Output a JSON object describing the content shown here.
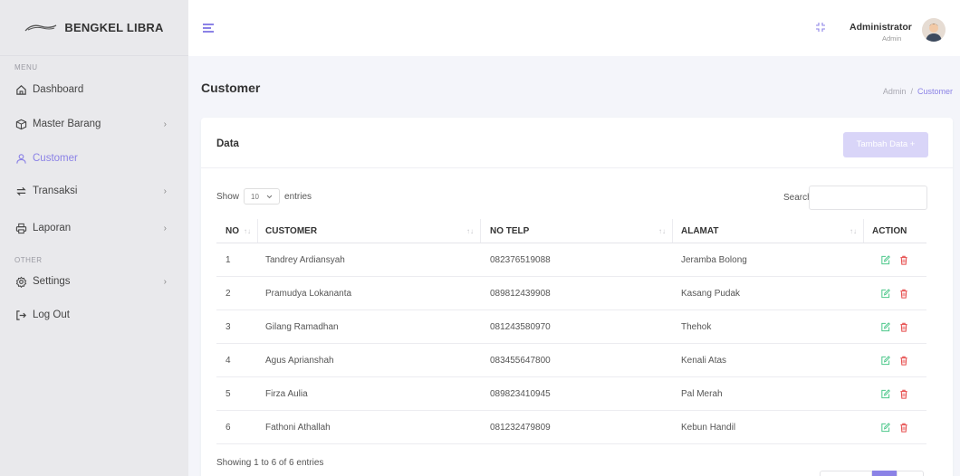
{
  "brand": {
    "name": "BENGKEL LIBRA"
  },
  "sidebar": {
    "menu_label": "MENU",
    "other_label": "OTHER",
    "items": [
      {
        "label": "Dashboard",
        "icon": "home-icon"
      },
      {
        "label": "Master Barang",
        "icon": "box-icon",
        "has_submenu": true
      },
      {
        "label": "Customer",
        "icon": "user-icon",
        "active": true
      },
      {
        "label": "Transaksi",
        "icon": "exchange-icon",
        "has_submenu": true
      },
      {
        "label": "Laporan",
        "icon": "printer-icon",
        "has_submenu": true
      },
      {
        "label": "Settings",
        "icon": "gear-icon",
        "has_submenu": true
      },
      {
        "label": "Log Out",
        "icon": "logout-icon"
      }
    ]
  },
  "topbar": {
    "user_name": "Administrator",
    "user_role": "Admin"
  },
  "page": {
    "title": "Customer",
    "breadcrumb": {
      "root": "Admin",
      "sep": "/",
      "current": "Customer"
    }
  },
  "card": {
    "title": "Data",
    "add_button": "Tambah Data +",
    "show_label": "Show",
    "entries_value": "10",
    "entries_label": "entries",
    "search_label": "Search:",
    "footer": "Showing 1 to 6 of 6 entries"
  },
  "table": {
    "columns": [
      "NO",
      "CUSTOMER",
      "NO TELP",
      "ALAMAT",
      "ACTION"
    ],
    "rows": [
      {
        "no": "1",
        "customer": "Tandrey Ardiansyah",
        "telp": "082376519088",
        "alamat": "Jeramba Bolong"
      },
      {
        "no": "2",
        "customer": "Pramudya Lokananta",
        "telp": "089812439908",
        "alamat": "Kasang Pudak"
      },
      {
        "no": "3",
        "customer": "Gilang Ramadhan",
        "telp": "081243580970",
        "alamat": "Thehok"
      },
      {
        "no": "4",
        "customer": "Agus Aprianshah",
        "telp": "083455647800",
        "alamat": "Kenali Atas"
      },
      {
        "no": "5",
        "customer": "Firza Aulia",
        "telp": "089823410945",
        "alamat": "Pal Merah"
      },
      {
        "no": "6",
        "customer": "Fathoni Athallah",
        "telp": "081232479809",
        "alamat": "Kebun Handil"
      }
    ]
  },
  "colors": {
    "accent": "#8b82e6",
    "edit": "#4cc78a",
    "delete": "#e64a4a"
  }
}
